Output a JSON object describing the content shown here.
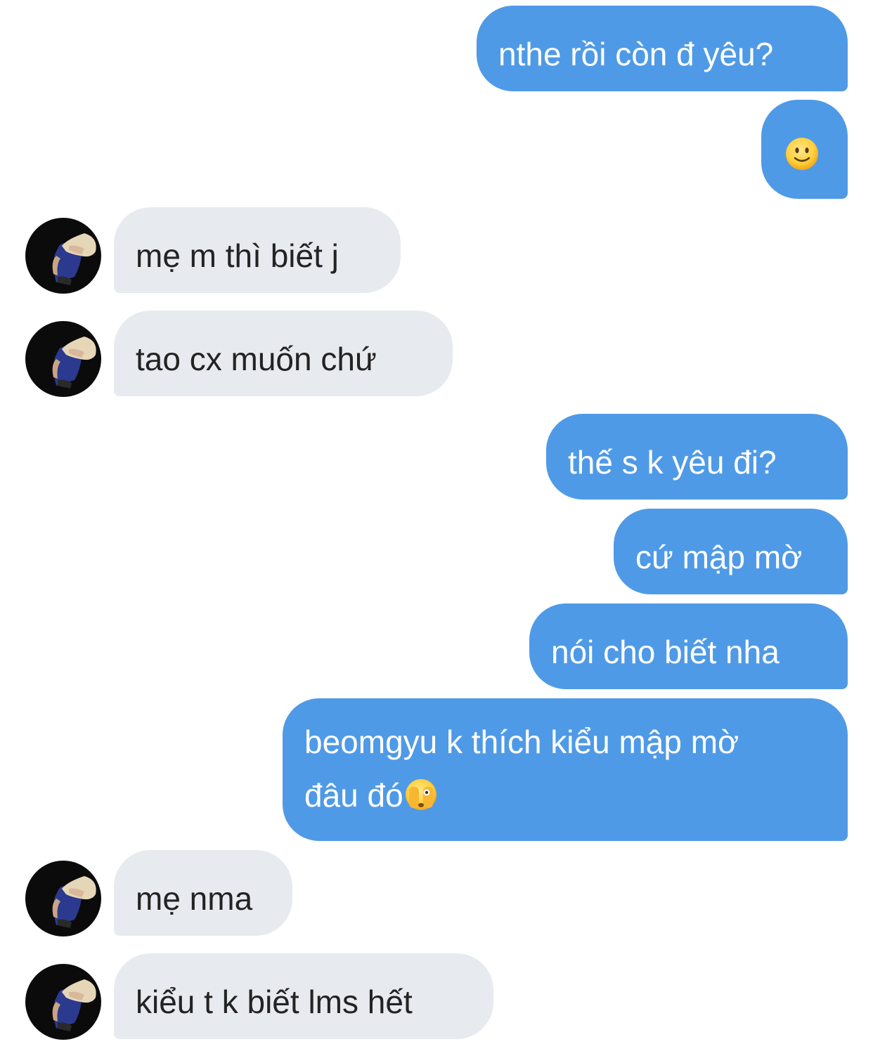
{
  "messages": [
    {
      "side": "out",
      "text": "nthe rồi còn đ yêu?"
    },
    {
      "side": "out",
      "emoji": "slightly-smiling-face"
    },
    {
      "side": "in",
      "text": "mẹ m thì biết j"
    },
    {
      "side": "in",
      "text": "tao cx muốn chứ"
    },
    {
      "side": "out",
      "text": "thế s k yêu đi?"
    },
    {
      "side": "out",
      "text": "cứ mập mờ"
    },
    {
      "side": "out",
      "text": "nói cho biết nha"
    },
    {
      "side": "out",
      "line1": "beomgyu k thích kiểu mập mờ",
      "line2": "đâu đó",
      "emoji": "face-with-hand-over-eyes"
    },
    {
      "side": "in",
      "text": "mẹ nma"
    },
    {
      "side": "in",
      "text": "kiểu t k biết lms hết"
    }
  ],
  "colors": {
    "outgoing_bubble": "#4f9ae6",
    "incoming_bubble": "#e7eaef",
    "outgoing_text": "#ffffff",
    "incoming_text": "#232323"
  }
}
